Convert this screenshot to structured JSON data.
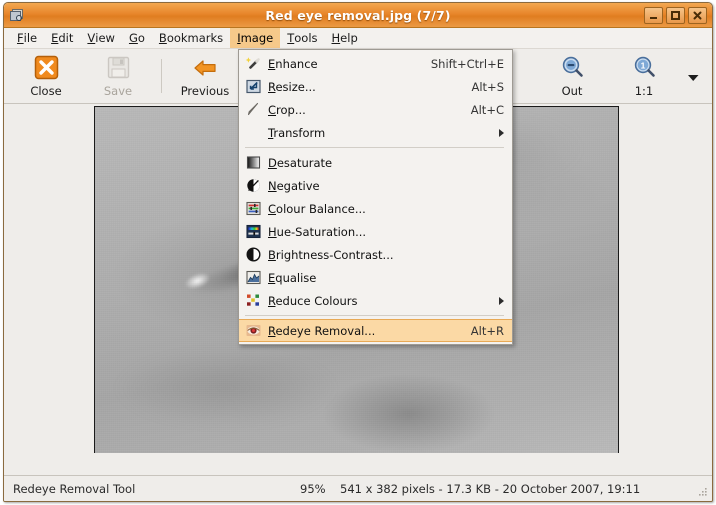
{
  "window": {
    "title": "Red eye removal.jpg  (7/7)",
    "icon": "image-viewer-icon",
    "buttons": {
      "minimize": "minimize-button",
      "maximize": "maximize-button",
      "close": "close-button"
    },
    "accent_color": "#e8862b",
    "background_color": "#efedea"
  },
  "menubar": {
    "items": [
      {
        "label": "File",
        "mnemonic": "F",
        "active": false
      },
      {
        "label": "Edit",
        "mnemonic": "E",
        "active": false
      },
      {
        "label": "View",
        "mnemonic": "V",
        "active": false
      },
      {
        "label": "Go",
        "mnemonic": "G",
        "active": false
      },
      {
        "label": "Bookmarks",
        "mnemonic": "B",
        "active": false
      },
      {
        "label": "Image",
        "mnemonic": "I",
        "active": true
      },
      {
        "label": "Tools",
        "mnemonic": "T",
        "active": false
      },
      {
        "label": "Help",
        "mnemonic": "H",
        "active": false
      }
    ],
    "highlight_color": "#f6c98a"
  },
  "toolbar": {
    "items": [
      {
        "label": "Close",
        "icon": "close-x-icon",
        "disabled": false
      },
      {
        "label": "Save",
        "icon": "floppy-disk-icon",
        "disabled": true
      },
      {
        "label": "Previous",
        "icon": "arrow-left-icon",
        "disabled": false
      },
      {
        "label": "Out",
        "icon": "zoom-out-icon",
        "disabled": false
      },
      {
        "label": "1:1",
        "icon": "zoom-actual-size-icon",
        "disabled": false
      }
    ],
    "overflow_icon": "chevron-down-icon"
  },
  "menu": {
    "name": "Image",
    "items": [
      {
        "type": "item",
        "label": "Redeye Removal...",
        "_placeholder_": false
      }
    ],
    "entries": [
      {
        "type": "item",
        "label": "Enhance",
        "mnemonic": "E",
        "accel": "Shift+Ctrl+E",
        "icon": "magic-wand-icon",
        "selected": false,
        "submenu": false
      },
      {
        "type": "item",
        "label": "Resize...",
        "mnemonic": "R",
        "accel": "Alt+S",
        "icon": "resize-icon",
        "selected": false,
        "submenu": false
      },
      {
        "type": "item",
        "label": "Crop...",
        "mnemonic": "C",
        "accel": "Alt+C",
        "icon": "crop-knife-icon",
        "selected": false,
        "submenu": false
      },
      {
        "type": "item",
        "label": "Transform",
        "mnemonic": "T",
        "accel": "",
        "icon": "none",
        "selected": false,
        "submenu": true
      },
      {
        "type": "separator"
      },
      {
        "type": "item",
        "label": "Desaturate",
        "mnemonic": "D",
        "accel": "",
        "icon": "desaturate-gradient-icon",
        "selected": false,
        "submenu": false
      },
      {
        "type": "item",
        "label": "Negative",
        "mnemonic": "N",
        "accel": "",
        "icon": "negative-circle-icon",
        "selected": false,
        "submenu": false
      },
      {
        "type": "item",
        "label": "Colour Balance...",
        "mnemonic": "C",
        "accel": "",
        "icon": "colour-balance-sliders-icon",
        "selected": false,
        "submenu": false
      },
      {
        "type": "item",
        "label": "Hue-Saturation...",
        "mnemonic": "H",
        "accel": "",
        "icon": "hue-saturation-icon",
        "selected": false,
        "submenu": false
      },
      {
        "type": "item",
        "label": "Brightness-Contrast...",
        "mnemonic": "B",
        "accel": "",
        "icon": "brightness-contrast-icon",
        "selected": false,
        "submenu": false
      },
      {
        "type": "item",
        "label": "Equalise",
        "mnemonic": "E",
        "accel": "",
        "icon": "histogram-icon",
        "selected": false,
        "submenu": false
      },
      {
        "type": "item",
        "label": "Reduce Colours",
        "mnemonic": "R",
        "accel": "",
        "icon": "colour-grid-icon",
        "selected": false,
        "submenu": true
      },
      {
        "type": "separator"
      },
      {
        "type": "item",
        "label": "Redeye Removal...",
        "mnemonic": "R",
        "accel": "Alt+R",
        "icon": "red-eye-icon",
        "selected": true,
        "submenu": false
      }
    ],
    "selected_background": "#fbd9a5"
  },
  "image_view": {
    "description": "grayscale close-up photograph of an eye",
    "zoom": "95%"
  },
  "statusbar": {
    "tool": "Redeye Removal Tool",
    "zoom": "95%",
    "info": "541 x 382 pixels - 17.3 KB - 20 October 2007, 19:11"
  }
}
